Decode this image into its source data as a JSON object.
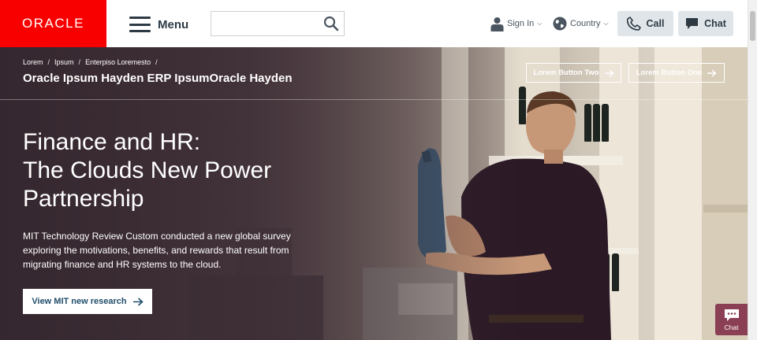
{
  "header": {
    "logo_text": "ORACLE",
    "menu_label": "Menu",
    "search": {
      "value": "",
      "placeholder": ""
    },
    "sign_in_label": "Sign In",
    "country_label": "Country",
    "call_label": "Call",
    "chat_label": "Chat"
  },
  "hero": {
    "breadcrumb": [
      "Lorem",
      "Ipsum",
      "Enterpiso Loremesto"
    ],
    "product_title": "Oracle Ipsum Hayden ERP IpsumOracle Hayden",
    "button_two_label": "Lorem Button Two",
    "button_one_label": "Lorem Button One",
    "headline_lines": [
      "Finance and HR:",
      "The Clouds New Power",
      "Partnership"
    ],
    "description": "MIT Technology Review Custom conducted a new global survey exploring the motivations, benefits, and rewards that result from migrating finance and HR systems to the cloud.",
    "cta_label": "View MIT new research",
    "chat_widget_label": "Chat"
  },
  "colors": {
    "brand_red": "#f80000",
    "nav_text": "#2d3a44",
    "pill_background": "#dfe5e9",
    "cta_text": "#1f4d6b",
    "chat_widget": "#8a3f55"
  },
  "icons": [
    "hamburger-icon",
    "search-icon",
    "user-icon",
    "globe-icon",
    "phone-icon",
    "chat-bubble-icon",
    "arrow-right-icon"
  ]
}
